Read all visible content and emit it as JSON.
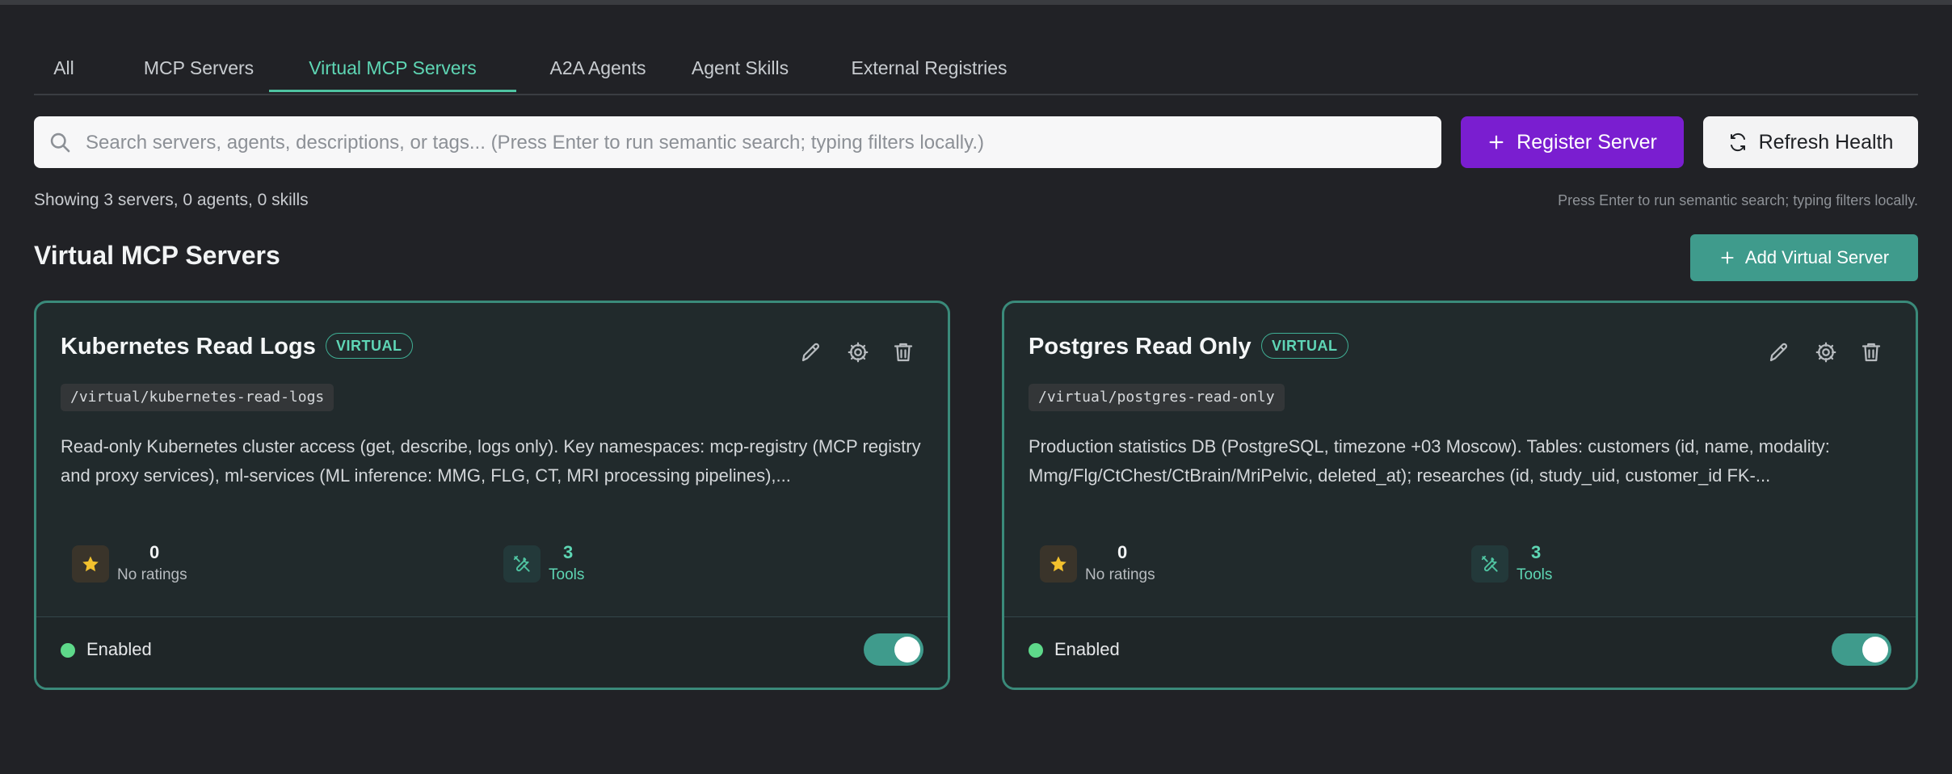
{
  "tabs": [
    {
      "label": "All"
    },
    {
      "label": "MCP Servers"
    },
    {
      "label": "Virtual MCP Servers",
      "active": true
    },
    {
      "label": "A2A Agents"
    },
    {
      "label": "Agent Skills"
    },
    {
      "label": "External Registries"
    }
  ],
  "search": {
    "placeholder": "Search servers, agents, descriptions, or tags... (Press Enter to run semantic search; typing filters locally.)",
    "value": ""
  },
  "toolbar": {
    "register_label": "Register Server",
    "refresh_label": "Refresh Health"
  },
  "summary": {
    "showing": "Showing 3 servers, 0 agents, 0 skills",
    "hint": "Press Enter to run semantic search; typing filters locally."
  },
  "section": {
    "title": "Virtual MCP Servers",
    "add_label": "Add Virtual Server"
  },
  "cards": [
    {
      "title": "Kubernetes Read Logs",
      "badge": "VIRTUAL",
      "path": "/virtual/kubernetes-read-logs",
      "description": "Read-only Kubernetes cluster access (get, describe, logs only). Key namespaces: mcp-registry (MCP registry and proxy services), ml-services (ML inference: MMG, FLG, CT, MRI processing pipelines),...",
      "ratings_count": "0",
      "ratings_label": "No ratings",
      "tools_count": "3",
      "tools_label": "Tools",
      "status_label": "Enabled",
      "enabled": true
    },
    {
      "title": "Postgres Read Only",
      "badge": "VIRTUAL",
      "path": "/virtual/postgres-read-only",
      "description": "Production statistics DB (PostgreSQL, timezone +03 Moscow). Tables: customers (id, name, modality: Mmg/Flg/CtChest/CtBrain/MriPelvic, deleted_at); researches (id, study_uid, customer_id FK-...",
      "ratings_count": "0",
      "ratings_label": "No ratings",
      "tools_count": "3",
      "tools_label": "Tools",
      "status_label": "Enabled",
      "enabled": true
    }
  ],
  "colors": {
    "accent": "#4fc3a1",
    "register": "#7a1ed0",
    "add_button": "#3f9b8c",
    "enabled_dot": "#5ed98a",
    "star": "#f2c12e"
  },
  "icons": {
    "search": "search-icon",
    "plus": "plus-icon",
    "refresh": "refresh-icon",
    "edit": "pencil-icon",
    "settings": "gear-icon",
    "delete": "trash-icon",
    "rating": "star-icon",
    "tools": "tools-icon"
  }
}
